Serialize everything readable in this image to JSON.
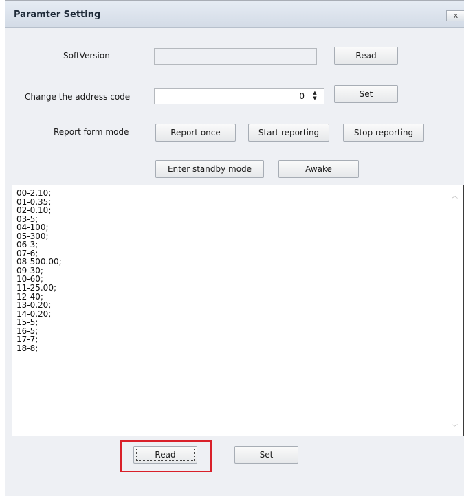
{
  "window": {
    "title": "Paramter Setting",
    "close_glyph": "x"
  },
  "soft_version": {
    "label": "SoftVersion",
    "value": "",
    "read_button": "Read"
  },
  "address_code": {
    "label": "Change the address code",
    "value": "0",
    "set_button": "Set"
  },
  "report_mode": {
    "label": "Report form mode",
    "report_once": "Report once",
    "start_reporting": "Start reporting",
    "stop_reporting": "Stop reporting"
  },
  "standby": {
    "enter_standby": "Enter standby mode",
    "awake": "Awake"
  },
  "parameters": {
    "lines": [
      "00-2.10;",
      "01-0.35;",
      "02-0.10;",
      "03-5;",
      "04-100;",
      "05-300;",
      "06-3;",
      "07-6;",
      "08-500.00;",
      "09-30;",
      "10-60;",
      "11-25.00;",
      "12-40;",
      "13-0.20;",
      "14-0.20;",
      "15-5;",
      "16-5;",
      "17-7;",
      "18-8;"
    ]
  },
  "bottom": {
    "read_button": "Read",
    "set_button": "Set"
  },
  "colors": {
    "highlight_border": "#d9202a",
    "dialog_background": "#eef0f4"
  },
  "icons": {
    "close": "close-icon",
    "spin_up": "spin-up-icon",
    "spin_down": "spin-down-icon",
    "scroll_up": "scroll-up-icon",
    "scroll_down": "scroll-down-icon"
  }
}
